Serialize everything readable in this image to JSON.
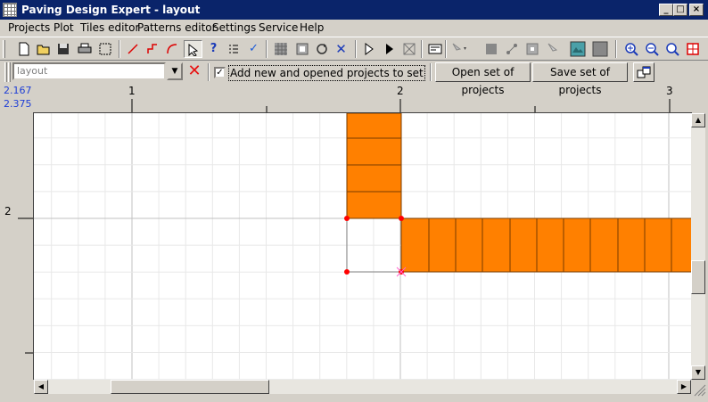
{
  "window": {
    "title": "Paving Design Expert - layout",
    "controls": {
      "minimize": "_",
      "maximize": "□",
      "close": "×"
    }
  },
  "menu": [
    "Projects",
    "Plot",
    "Tiles editor",
    "Patterns editor",
    "Settings",
    "Service",
    "Help"
  ],
  "toolbar": {
    "icons": [
      "new-icon",
      "open-icon",
      "save-icon",
      "print-icon",
      "select-rect-icon",
      "line-icon",
      "polyline-icon",
      "arc-icon",
      "select-pointer-icon",
      "help-cursor-icon",
      "checklist-icon",
      "check-icon",
      "grid-pattern-icon",
      "tile-icon",
      "rotate-icon",
      "cross-icon",
      "play-pointer-icon",
      "play-icon",
      "box-x-icon",
      "envelope-icon",
      "arrow-select-icon",
      "filled-square-icon",
      "node-icon",
      "center-icon",
      "pointer-x-icon",
      "teal-image-icon",
      "gray-square-icon",
      "zoom-in-icon",
      "zoom-out-icon",
      "zoom-fit-icon",
      "frame-red-icon"
    ]
  },
  "toolbar2": {
    "layout_select": {
      "placeholder": "layout"
    },
    "add_projects_checkbox": {
      "checked": true,
      "label": "Add new and opened projects to set"
    },
    "open_set_button": "Open set of projects",
    "save_set_button": "Save set of projects"
  },
  "coords": {
    "x": "2.167",
    "y": "2.375"
  },
  "ruler": {
    "horizontal_labels": [
      "1",
      "2",
      "3"
    ],
    "vertical_labels": [
      "2"
    ]
  },
  "colors": {
    "tile": "#ff8000",
    "tile_border": "#7a3d00",
    "grid_minor": "#e8e8e8",
    "grid_major": "#c0c0c0",
    "vertex": "#ff0000",
    "coord_text": "#1f3fd6"
  }
}
